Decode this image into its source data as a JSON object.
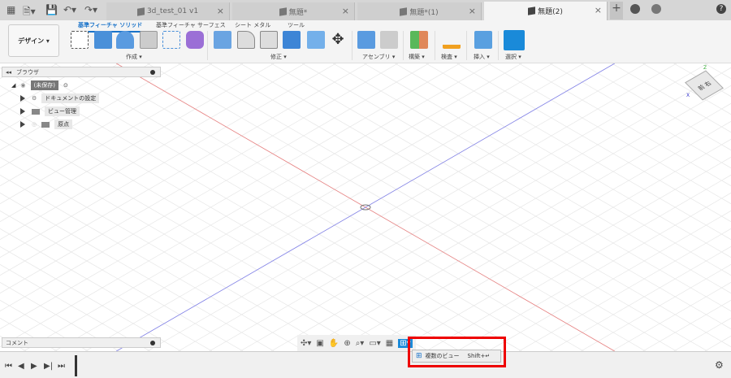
{
  "tabs": [
    {
      "label": "3d_test_01 v1",
      "active": false
    },
    {
      "label": "無題*",
      "active": false
    },
    {
      "label": "無題*(1)",
      "active": false
    },
    {
      "label": "無題(2)",
      "active": true
    }
  ],
  "toolbar": {
    "workspace": "デザイン ▾",
    "ribbon_tabs": [
      "基準フィーチャ ソリッド",
      "基準フィーチャ サーフェス",
      "シート メタル",
      "ツール"
    ],
    "groups": [
      "作成 ▾",
      "修正 ▾",
      "アセンブリ ▾",
      "構築 ▾",
      "検査 ▾",
      "挿入 ▾",
      "選択 ▾"
    ]
  },
  "browser": {
    "title": "ブラウザ",
    "root": "(未保存)",
    "items": [
      "ドキュメントの設定",
      "ビュー管理",
      "原点"
    ]
  },
  "comment": {
    "title": "コメント"
  },
  "viewcube": {
    "front": "前",
    "right": "右",
    "z": "Z",
    "x": "X"
  },
  "menu": {
    "label": "複数のビュー",
    "shortcut": "Shift+↵"
  },
  "colors": {
    "accent": "#1a73c9",
    "x_axis": "#e88080",
    "z_axis": "#8080e8",
    "highlight": "#e00000"
  }
}
